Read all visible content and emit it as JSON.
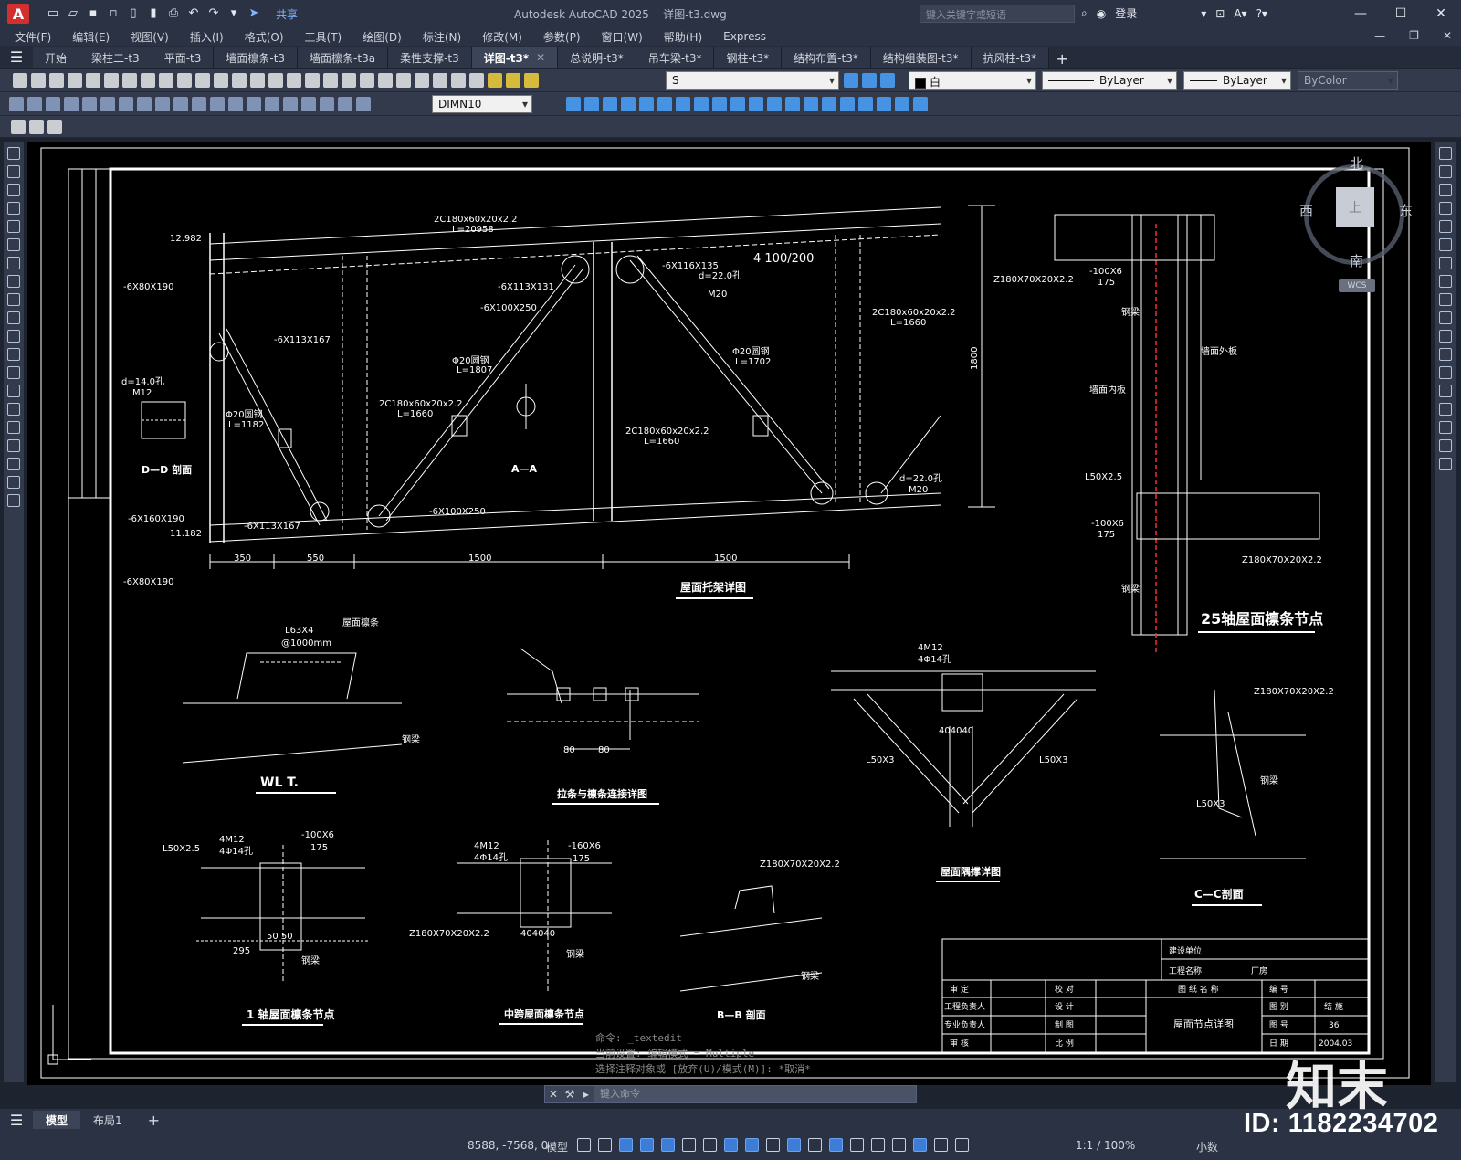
{
  "app": {
    "title": "Autodesk AutoCAD 2025",
    "file": "详图-t3.dwg",
    "logo": "A",
    "share": "共享",
    "search_placeholder": "键入关键字或短语",
    "login": "登录"
  },
  "menu": [
    "文件(F)",
    "编辑(E)",
    "视图(V)",
    "插入(I)",
    "格式(O)",
    "工具(T)",
    "绘图(D)",
    "标注(N)",
    "修改(M)",
    "参数(P)",
    "窗口(W)",
    "帮助(H)",
    "Express"
  ],
  "tabs": [
    {
      "label": "开始",
      "active": false
    },
    {
      "label": "梁柱二-t3",
      "active": false
    },
    {
      "label": "平面-t3",
      "active": false
    },
    {
      "label": "墙面檩条-t3",
      "active": false
    },
    {
      "label": "墙面檩条-t3a",
      "active": false
    },
    {
      "label": "柔性支撑-t3",
      "active": false
    },
    {
      "label": "详图-t3*",
      "active": true
    },
    {
      "label": "总说明-t3*",
      "active": false
    },
    {
      "label": "吊车梁-t3*",
      "active": false
    },
    {
      "label": "钢柱-t3*",
      "active": false
    },
    {
      "label": "结构布置-t3*",
      "active": false
    },
    {
      "label": "结构组装图-t3*",
      "active": false
    },
    {
      "label": "抗风柱-t3*",
      "active": false
    }
  ],
  "properties": {
    "layer": "S",
    "color": "白",
    "linetype": "ByLayer",
    "lineweight": "ByLayer",
    "plotstyle": "ByColor",
    "dimstyle": "DIMN10"
  },
  "viewcube": {
    "north": "北",
    "south": "南",
    "west": "西",
    "east": "东",
    "top": "上",
    "wcs": "WCS"
  },
  "drawing": {
    "titles": {
      "truss": "屋面托架详图",
      "axis25": "25轴屋面檩条节点",
      "wlt": "WL T.",
      "tie": "拉条与檩条连接详图",
      "brace": "屋面隅撑详图",
      "cc": "C—C剖面",
      "axis1": "1 轴屋面檩条节点",
      "mid": "中跨屋面檩条节点",
      "bb": "B—B 剖面",
      "dd": "D—D 剖面",
      "aa": "A—A"
    },
    "labels": {
      "top_chord": "2C180x60x20x2.2",
      "top_chord_len": "L=20958",
      "slope": "4 100/200",
      "web1": "2C180x60x20x2.2",
      "web1_len": "L=1660",
      "web2": "2C180x60x20x2.2",
      "web2_len": "L=1660",
      "web3": "2C180x60x20x2.2",
      "web3_len": "L=1660",
      "rod1": "Φ20圆钢",
      "rod1_len": "L=1807",
      "rod2": "Φ20圆钢",
      "rod2_len": "L=1702",
      "rod3": "Φ20圆钢",
      "rod3_len": "L=1182",
      "pl_113": "-6X113X131",
      "pl_116": "-6X116X135",
      "pl_100": "-6X100X250",
      "pl_80": "-6X80X190",
      "pl_160": "-6X160X190",
      "pl_167": "-6X113X167",
      "bolt": "d=22.0孔",
      "bolt_m": "M20",
      "bolt2": "d=14.0孔",
      "bolt2_m": "M12",
      "height": "1800",
      "dim350": "350",
      "dim550": "550",
      "dim1500a": "1500",
      "dim1500b": "1500",
      "elev": "12.982",
      "elev2": "11.182",
      "z180": "Z180X70X20X2.2",
      "l50": "L50X2.5",
      "pl_100x6": "-100X6",
      "d175": "175",
      "wall_outer": "墙面外板",
      "wall_inner": "墙面内板",
      "steel_beam": "钢梁",
      "l63": "L63X4",
      "at1000": "@1000mm",
      "roof_purlin": "屋面檩条",
      "m12_4": "4M12",
      "hole4": "4Φ14孔",
      "l50x3": "L50X3",
      "pl_160x6": "-160X6",
      "dim80a": "80",
      "dim80b": "80",
      "dim295": "295",
      "dim5050": "50 50",
      "dim404040": "404040"
    },
    "titleblock": {
      "owner": "建设单位",
      "project": "工程名称",
      "project_val": "厂房",
      "rows": [
        [
          "审  定",
          "",
          "校  对",
          ""
        ],
        [
          "工程负责人",
          "",
          "设  计",
          ""
        ],
        [
          "专业负责人",
          "",
          "制  图",
          ""
        ],
        [
          "审  核",
          "",
          "比  例",
          ""
        ]
      ],
      "drawing_name_hdr": "图  纸  名  称",
      "drawing_name": "屋面节点详图",
      "no_hdr": "编 号",
      "cat_hdr": "图 别",
      "cat_val": "结 施",
      "num_hdr": "图 号",
      "num_val": "36",
      "date_hdr": "日 期",
      "date_val": "2004.03"
    }
  },
  "command": {
    "history": [
      "命令: _textedit",
      "当前设置: 编辑模式 = Multiple",
      "选择注释对象或 [放弃(U)/模式(M)]: *取消*"
    ],
    "placeholder": "键入命令"
  },
  "layouts": [
    {
      "label": "模型",
      "active": true
    },
    {
      "label": "布局1",
      "active": false
    }
  ],
  "status": {
    "coords": "8588, -7568, 0",
    "space": "模型",
    "scale": "1:1 / 100%",
    "units": "小数"
  },
  "watermark": {
    "id": "ID: 1182234702",
    "logo": "知末"
  }
}
